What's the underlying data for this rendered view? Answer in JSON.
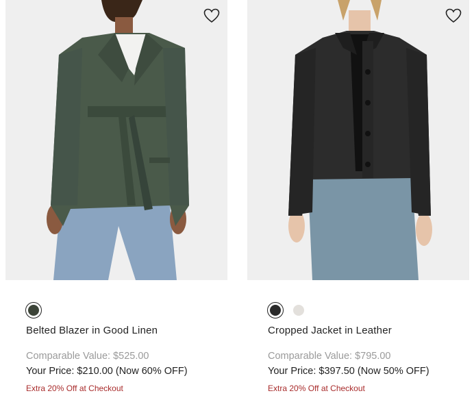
{
  "products": [
    {
      "name": "Belted Blazer in Good Linen",
      "comparable": "Comparable Value: $525.00",
      "price": "Your Price: $210.00 (Now 60% OFF)",
      "promo": "Extra 20% Off at Checkout",
      "swatches": [
        {
          "color": "#3c4438",
          "selected": true
        }
      ],
      "wishlist_icon": "heart-outline-icon"
    },
    {
      "name": "Cropped Jacket in Leather",
      "comparable": "Comparable Value: $795.00",
      "price": "Your Price: $397.50 (Now 50% OFF)",
      "promo": "Extra 20% Off at Checkout",
      "swatches": [
        {
          "color": "#2a2a2a",
          "selected": true
        },
        {
          "color": "#e3e0dc",
          "selected": false
        }
      ],
      "wishlist_icon": "heart-outline-icon"
    }
  ],
  "colors": {
    "promo": "#a82b2b",
    "muted": "#9a9a9a",
    "image_bg": "#efefef"
  }
}
